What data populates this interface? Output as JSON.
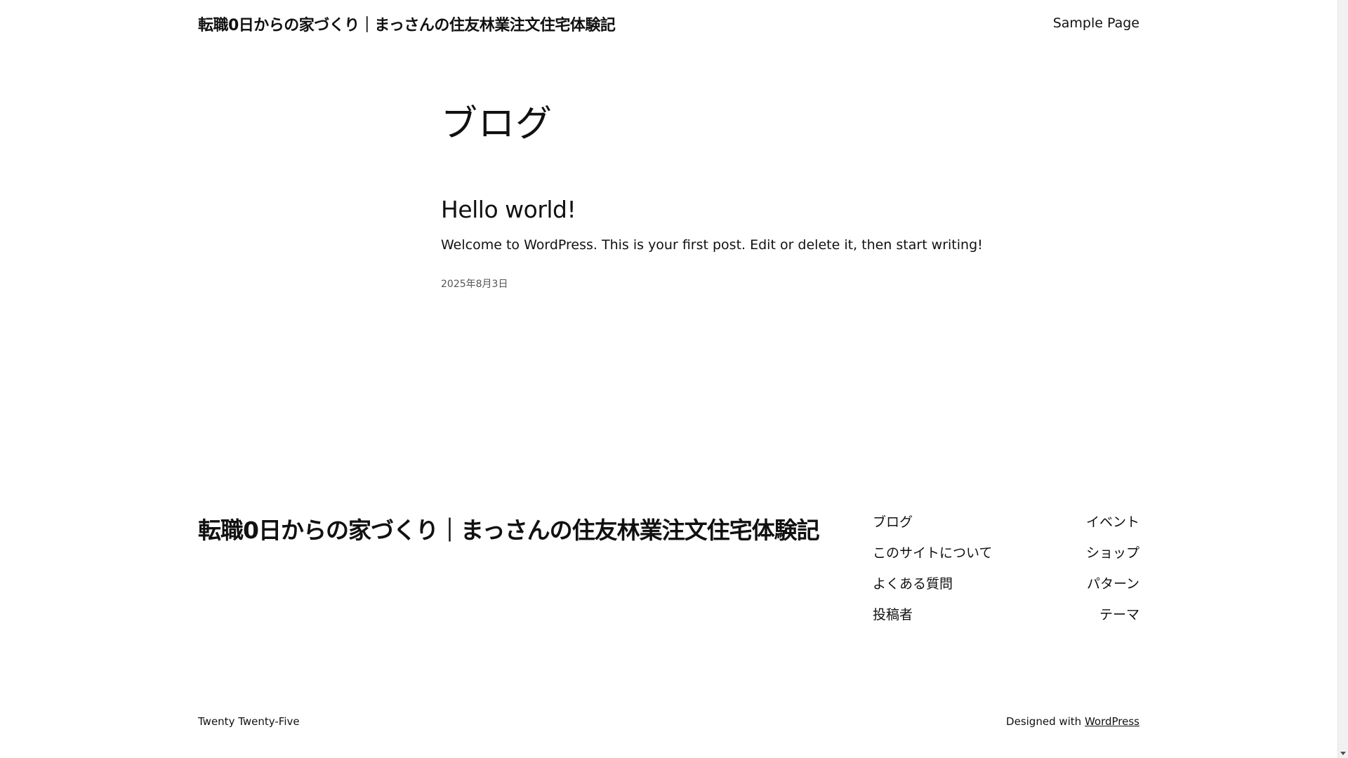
{
  "header": {
    "site_title": "転職0日からの家づくり｜まっさんの住友林業注文住宅体験記",
    "nav": [
      "Sample Page"
    ]
  },
  "main": {
    "page_heading": "ブログ",
    "post": {
      "title": "Hello world!",
      "excerpt": "Welcome to WordPress. This is your first post. Edit or delete it, then start writing!",
      "date": "2025年8月3日"
    }
  },
  "footer": {
    "site_title": "転職0日からの家づくり｜まっさんの住友林業注文住宅体験記",
    "nav_left": [
      "ブログ",
      "このサイトについて",
      "よくある質問",
      "投稿者"
    ],
    "nav_right": [
      "イベント",
      "ショップ",
      "パターン",
      "テーマ"
    ],
    "theme_name": "Twenty Twenty-Five",
    "credit_prefix": "Designed with ",
    "credit_link": "WordPress"
  }
}
